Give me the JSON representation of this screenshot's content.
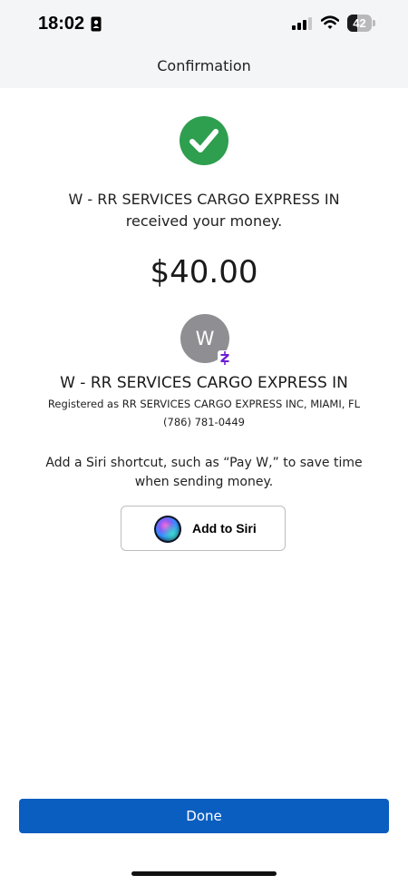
{
  "status_bar": {
    "time": "18:02",
    "battery": "42",
    "battery_level": 0.42,
    "icons": [
      "id-badge-icon",
      "signal-icon",
      "wifi-icon",
      "battery-icon"
    ]
  },
  "header": {
    "title": "Confirmation"
  },
  "confirmation": {
    "status_icon": "checkmark-circle-icon",
    "message": "W - RR SERVICES CARGO EXPRESS IN received your money.",
    "amount": "$40.00"
  },
  "recipient": {
    "avatar_initial": "W",
    "badge_icon": "zelle-icon",
    "name": "W - RR SERVICES CARGO EXPRESS IN",
    "registered": "Registered as RR SERVICES CARGO EXPRESS INC, MIAMI, FL",
    "phone": "(786) 781-0449"
  },
  "siri": {
    "message": "Add a Siri shortcut, such as “Pay W,” to save time when sending money.",
    "button_label": "Add to Siri",
    "icon": "siri-icon"
  },
  "footer": {
    "done_label": "Done"
  },
  "colors": {
    "success": "#2e9e4f",
    "primary": "#0a5ec0",
    "zelle": "#6d1ed4",
    "avatar": "#8e8e93",
    "header_bg": "#f4f5f6"
  }
}
